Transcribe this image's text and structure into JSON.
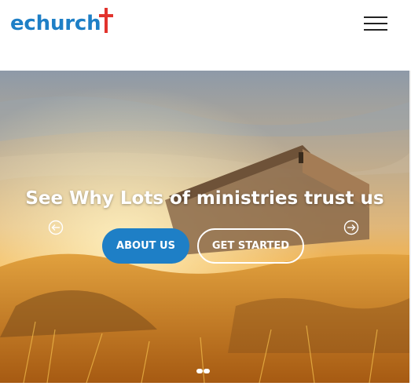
{
  "header": {
    "logo_text": "echurch",
    "brand_color": "#1e7fc6",
    "cross_color": "#e2332d",
    "menu_icon": "hamburger-menu-icon"
  },
  "hero": {
    "headline": "See Why Lots of ministries trust us",
    "prev_icon": "arrow-left-circle-icon",
    "next_icon": "arrow-right-circle-icon",
    "buttons": {
      "about": "ABOUT US",
      "start": "GET STARTED"
    },
    "slider_dots": 2,
    "active_dot": 1
  }
}
